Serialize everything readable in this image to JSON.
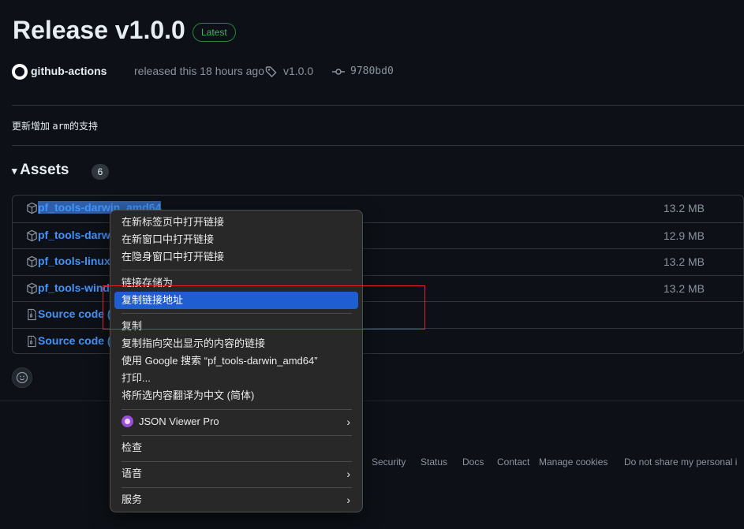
{
  "release": {
    "title": "Release v1.0.0",
    "badge": "Latest",
    "author": "github-actions",
    "released_text": "released this 18 hours ago",
    "tag": "v1.0.0",
    "commit": "9780bd0",
    "body_prefix": "更新增加 ",
    "body_code": "arm",
    "body_suffix": "的支持"
  },
  "assets": {
    "heading": "Assets",
    "count": "6",
    "rows": [
      {
        "name": "pf_tools-darwin_amd64",
        "size": "13.2 MB",
        "icon": "package-icon"
      },
      {
        "name": "pf_tools-darwin_arm64",
        "size": "12.9 MB",
        "icon": "package-icon"
      },
      {
        "name": "pf_tools-linux_amd64",
        "size": "13.2 MB",
        "icon": "package-icon"
      },
      {
        "name": "pf_tools-windows_amd64.exe",
        "size": "13.2 MB",
        "icon": "package-icon"
      },
      {
        "name": "Source code (zip)",
        "size": "",
        "icon": "file-zip-icon"
      },
      {
        "name": "Source code (tar.gz)",
        "size": "",
        "icon": "file-zip-icon"
      }
    ]
  },
  "footer": {
    "links": [
      "Security",
      "Status",
      "Docs",
      "Contact",
      "Manage cookies",
      "Do not share my personal i"
    ]
  },
  "context_menu": {
    "items": [
      "在新标签页中打开链接",
      "在新窗口中打开链接",
      "在隐身窗口中打开链接",
      "链接存储为",
      "复制链接地址",
      "复制",
      "复制指向突出显示的内容的链接",
      "使用 Google 搜索 “pf_tools-darwin_amd64”",
      "打印...",
      "将所选内容翻译为中文 (简体)",
      "JSON Viewer Pro",
      "检查",
      "语音",
      "服务"
    ],
    "highlighted_index": 4
  },
  "colors": {
    "background": "#0d1117",
    "link": "#4493f8",
    "badge_green": "#3fb950",
    "menu_highlight": "#1f5ed1",
    "annotation_red": "#e0202a"
  }
}
